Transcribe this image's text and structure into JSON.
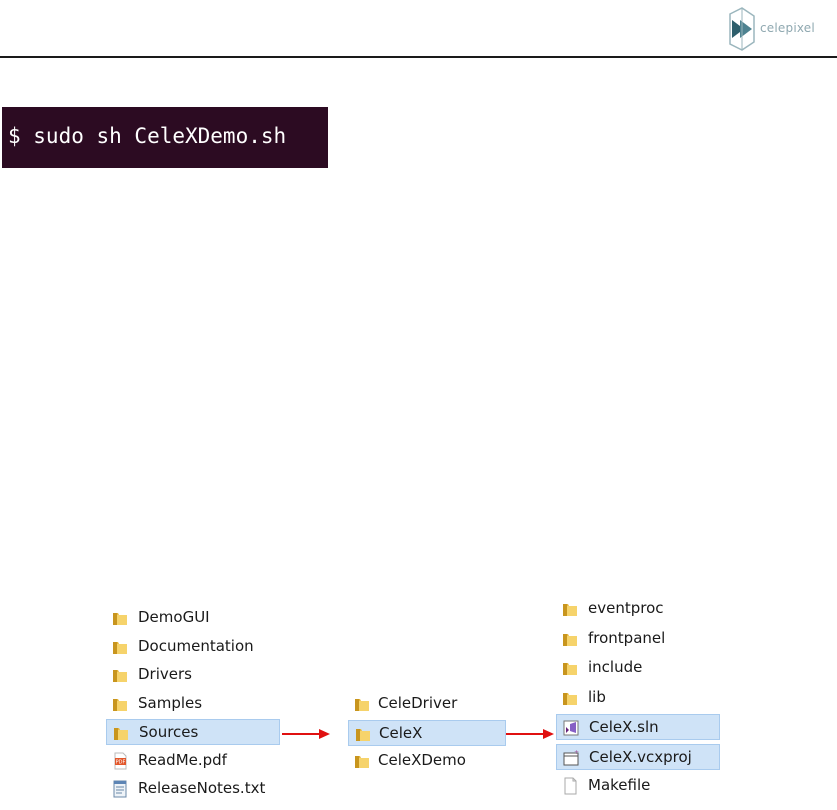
{
  "header": {
    "logo_text": "celepixel"
  },
  "terminal": {
    "command": "$ sudo sh CeleXDemo.sh"
  },
  "explorer": {
    "root_items": [
      {
        "name": "DemoGUI",
        "icon": "folder-icon"
      },
      {
        "name": "Documentation",
        "icon": "folder-icon"
      },
      {
        "name": "Drivers",
        "icon": "folder-icon"
      },
      {
        "name": "Samples",
        "icon": "folder-icon"
      },
      {
        "name": "Sources",
        "icon": "folder-icon",
        "selected": true
      },
      {
        "name": "ReadMe.pdf",
        "icon": "pdf-file-icon"
      },
      {
        "name": "ReleaseNotes.txt",
        "icon": "text-file-icon"
      }
    ],
    "sources_items": [
      {
        "name": "CeleDriver",
        "icon": "folder-icon"
      },
      {
        "name": "CeleX",
        "icon": "folder-icon",
        "selected": true
      },
      {
        "name": "CeleXDemo",
        "icon": "folder-icon"
      }
    ],
    "celex_items": [
      {
        "name": "eventproc",
        "icon": "folder-icon"
      },
      {
        "name": "frontpanel",
        "icon": "folder-icon"
      },
      {
        "name": "include",
        "icon": "folder-icon"
      },
      {
        "name": "lib",
        "icon": "folder-icon"
      },
      {
        "name": "CeleX.sln",
        "icon": "vs-solution-icon",
        "selected": true
      },
      {
        "name": "CeleX.vcxproj",
        "icon": "vcxproj-file-icon",
        "selected": true
      },
      {
        "name": "Makefile",
        "icon": "blank-file-icon"
      }
    ]
  },
  "colors": {
    "terminal_bg": "#2c0b22",
    "arrow": "#e01010",
    "selection": "#cfe3f7"
  }
}
